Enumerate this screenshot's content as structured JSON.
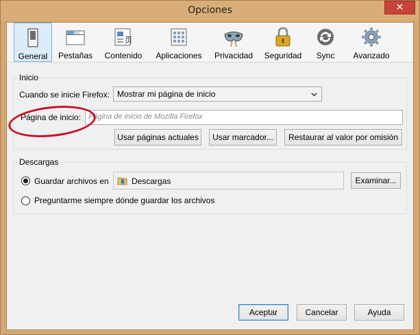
{
  "window": {
    "title": "Opciones",
    "close_glyph": "✕"
  },
  "toolbar": {
    "items": [
      {
        "label": "General",
        "icon": "switch-icon",
        "selected": true
      },
      {
        "label": "Pestañas",
        "icon": "tabs-window-icon",
        "selected": false
      },
      {
        "label": "Contenido",
        "icon": "content-page-icon",
        "selected": false
      },
      {
        "label": "Aplicaciones",
        "icon": "applications-icon",
        "selected": false
      },
      {
        "label": "Privacidad",
        "icon": "mask-icon",
        "selected": false
      },
      {
        "label": "Seguridad",
        "icon": "padlock-icon",
        "selected": false
      },
      {
        "label": "Sync",
        "icon": "sync-icon",
        "selected": false
      },
      {
        "label": "Avanzado",
        "icon": "gear-icon",
        "selected": false
      }
    ]
  },
  "startup": {
    "group_title": "Inicio",
    "when_label": "Cuando se inicie Firefox:",
    "when_value": "Mostrar mi página de inicio",
    "homepage_label": "Página de inicio:",
    "homepage_placeholder": "Página de inicio de Mozilla Firefox",
    "use_current_button": "Usar páginas actuales",
    "use_bookmark_button": "Usar marcador...",
    "restore_default_button": "Restaurar al valor por omisión"
  },
  "downloads": {
    "group_title": "Descargas",
    "save_to_label": "Guardar archivos en",
    "save_to_folder": "Descargas",
    "browse_button": "Examinar...",
    "ask_label": "Preguntarme siempre dónde guardar los archivos",
    "selected_option": "save_to"
  },
  "footer": {
    "accept_button": "Aceptar",
    "cancel_button": "Cancelar",
    "help_button": "Ayuda"
  },
  "colors": {
    "window_frame": "#d3a872",
    "close_button": "#c7443a",
    "selected_tab": "#dcecfb",
    "annotation_red": "#c7102a"
  }
}
